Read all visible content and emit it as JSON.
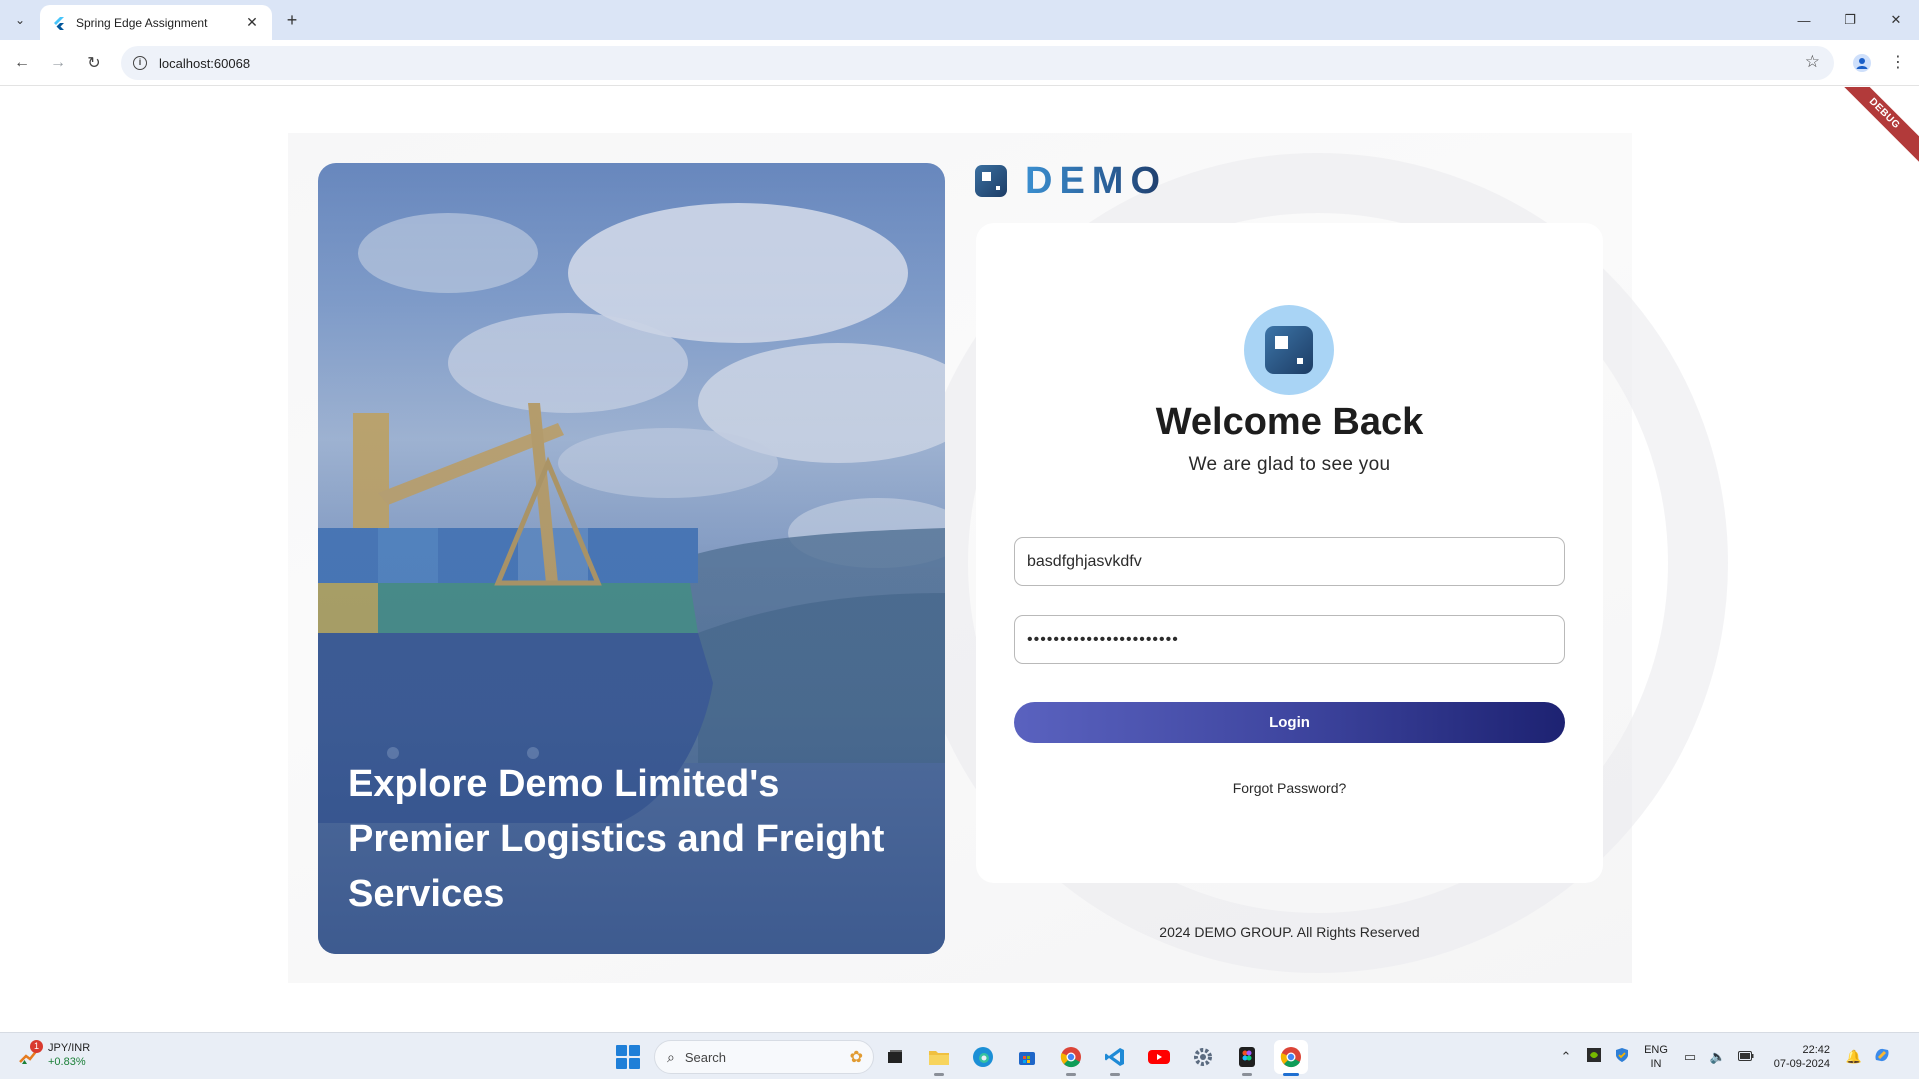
{
  "browser": {
    "tab_title": "Spring Edge Assignment",
    "tab_close": "✕",
    "new_tab": "+",
    "url": "localhost:60068",
    "window_controls": {
      "minimize": "—",
      "restore": "❐",
      "close": "✕"
    }
  },
  "page": {
    "debug_banner": "DEBUG",
    "brand_name": "DEMO",
    "hero_caption": "Explore Demo Limited's Premier Logistics and Freight Services",
    "welcome_title": "Welcome Back",
    "welcome_subtitle": "We are glad to see you",
    "username_value": "basdfghjasvkdfv",
    "password_value": "•••••••••••••••••••••••",
    "login_label": "Login",
    "forgot_password": "Forgot Password?",
    "copyright": "2024 DEMO GROUP. All Rights Reserved",
    "colors": {
      "brand_blue": "#2a5f98",
      "logo_circle": "#a9d4f5",
      "button_start": "#5a62bf",
      "button_end": "#1d2272"
    }
  },
  "taskbar": {
    "widget_name": "JPY/INR",
    "widget_change": "+0.83%",
    "widget_badge": "1",
    "search_placeholder": "Search",
    "apps": [
      "file-explorer-icon",
      "edge-icon",
      "store-icon",
      "chrome-icon",
      "vscode-icon",
      "youtube-icon",
      "settings-icon",
      "figma-icon",
      "chrome-active-icon"
    ],
    "language_line1": "ENG",
    "language_line2": "IN",
    "time": "22:42",
    "date": "07-09-2024"
  }
}
